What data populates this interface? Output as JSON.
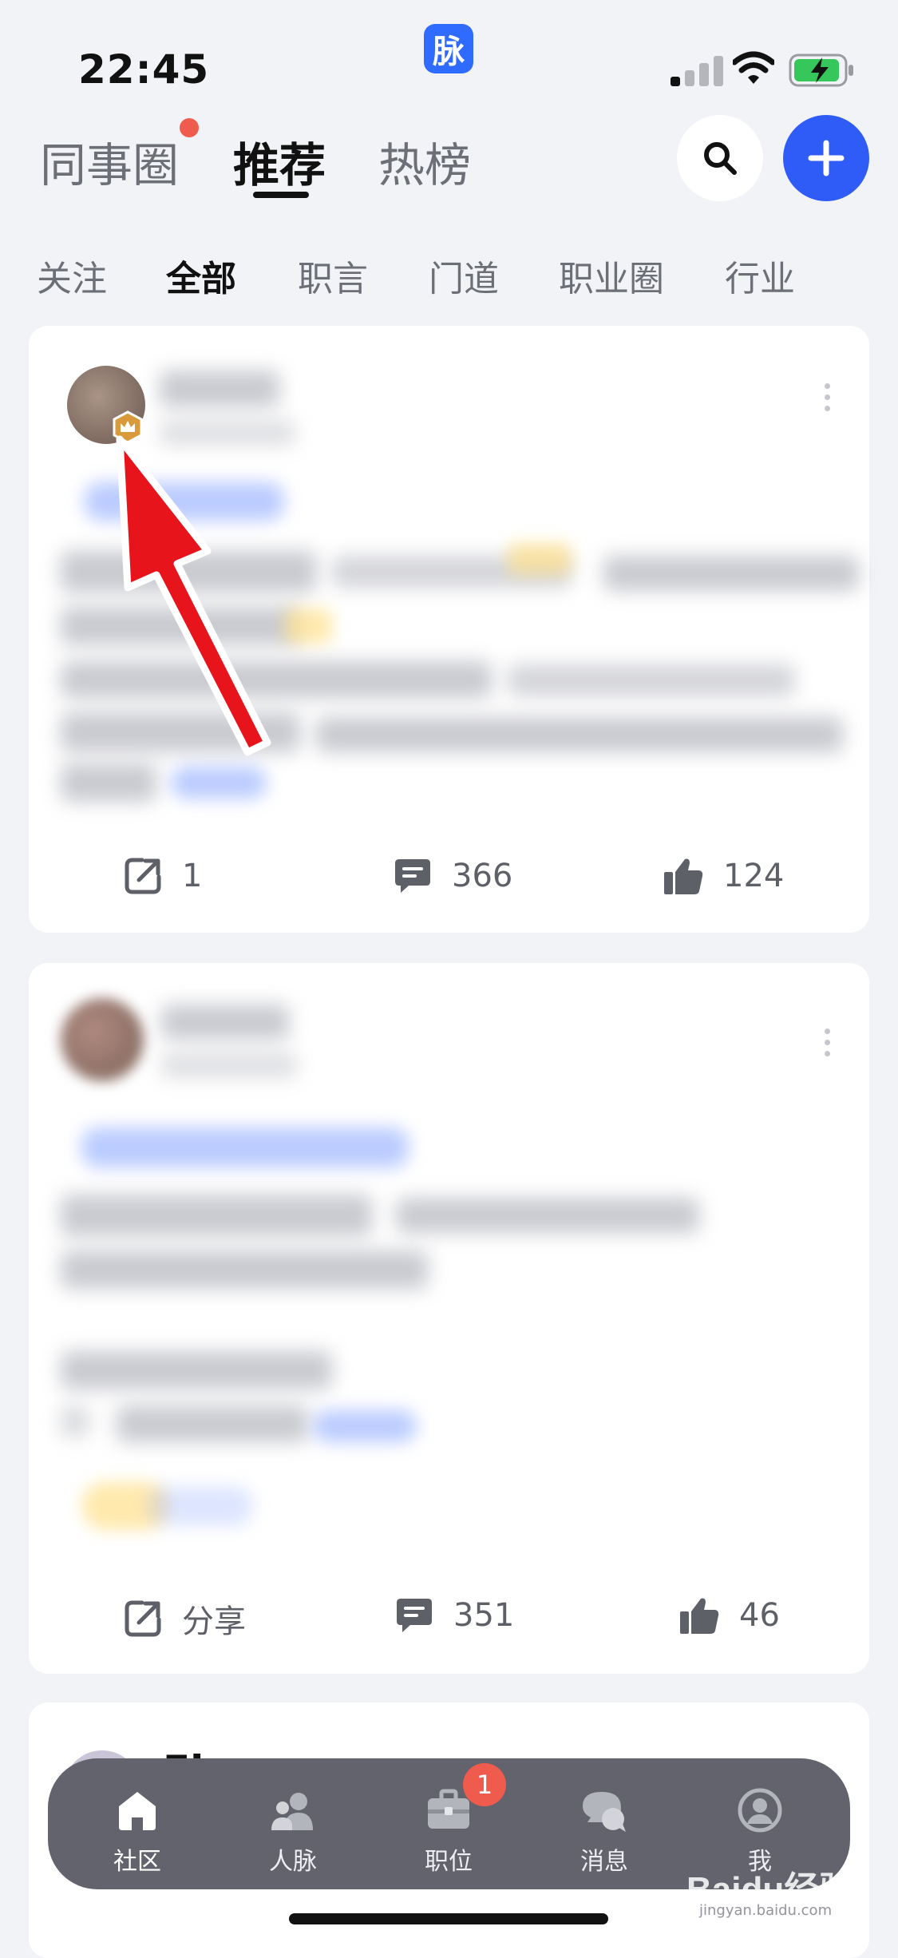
{
  "status_bar": {
    "time": "22:45",
    "app_badge": "脉"
  },
  "header": {
    "tabs": [
      {
        "label": "同事圈",
        "has_dot": true
      },
      {
        "label": "推荐",
        "active": true
      },
      {
        "label": "热榜"
      }
    ],
    "search_icon": "search-icon",
    "add_icon": "plus-icon"
  },
  "subtabs": [
    "关注",
    "全部",
    "职言",
    "门道",
    "职业圈",
    "行业"
  ],
  "subtab_active": "全部",
  "posts": [
    {
      "share_label": "1",
      "comment_count": "366",
      "like_count": "124"
    },
    {
      "share_label": "分享",
      "comment_count": "351",
      "like_count": "46"
    }
  ],
  "third_post": {
    "author_partial": "Ei"
  },
  "bottom_nav": [
    {
      "label": "社区",
      "icon": "home-icon",
      "active": true
    },
    {
      "label": "人脉",
      "icon": "contacts-icon"
    },
    {
      "label": "职位",
      "icon": "briefcase-icon",
      "badge": "1"
    },
    {
      "label": "消息",
      "icon": "chat-bubbles-icon"
    },
    {
      "label": "我",
      "icon": "profile-icon"
    }
  ],
  "watermark": {
    "text": "Baidu经验",
    "sub": "jingyan.baidu.com"
  },
  "colors": {
    "accent": "#2f5cf6",
    "badge_red": "#ef5b4c",
    "arrow_red": "#e8141c",
    "background": "#f2f3f7"
  }
}
